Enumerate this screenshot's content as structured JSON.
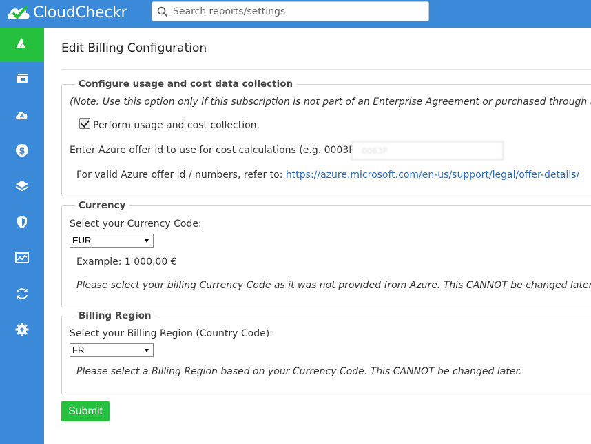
{
  "app": {
    "name": "CloudCheckr",
    "brand_color": "#3b8ad9",
    "accent_color": "#25c13e"
  },
  "search": {
    "placeholder": "Search reports/settings",
    "value": ""
  },
  "sidebar": {
    "items": [
      {
        "icon": "azure-icon",
        "active": true
      },
      {
        "icon": "inventory-icon",
        "active": false
      },
      {
        "icon": "cloud-upload-icon",
        "active": false
      },
      {
        "icon": "dollar-icon",
        "active": false
      },
      {
        "icon": "layers-icon",
        "active": false
      },
      {
        "icon": "shield-icon",
        "active": false
      },
      {
        "icon": "chart-icon",
        "active": false
      },
      {
        "icon": "sync-icon",
        "active": false
      },
      {
        "icon": "gear-icon",
        "active": false
      }
    ]
  },
  "page": {
    "title": "Edit Billing Configuration"
  },
  "usage": {
    "legend": "Configure usage and cost data collection",
    "note": "(Note: Use this option only if this subscription is not part of an Enterprise Agreement or purchased through a",
    "checkbox_label": "Perform usage and cost collection.",
    "checkbox_checked": true,
    "offer_label": "Enter Azure offer id to use for cost calculations (e.g. 0003P)",
    "offer_value": "0063P",
    "refer_label": "For valid Azure offer id / numbers, refer to: ",
    "refer_link": "https://azure.microsoft.com/en-us/support/legal/offer-details/"
  },
  "currency": {
    "legend": "Currency",
    "label": "Select your Currency Code:",
    "selected": "EUR",
    "example": "Example: 1 000,00 €",
    "warning": "Please select your billing Currency Code as it was not provided from Azure. This CANNOT be changed later."
  },
  "region": {
    "legend": "Billing Region",
    "label": "Select your Billing Region (Country Code):",
    "selected": "FR",
    "warning": "Please select a Billing Region based on your Currency Code. This CANNOT be changed later."
  },
  "submit_label": "Submit"
}
